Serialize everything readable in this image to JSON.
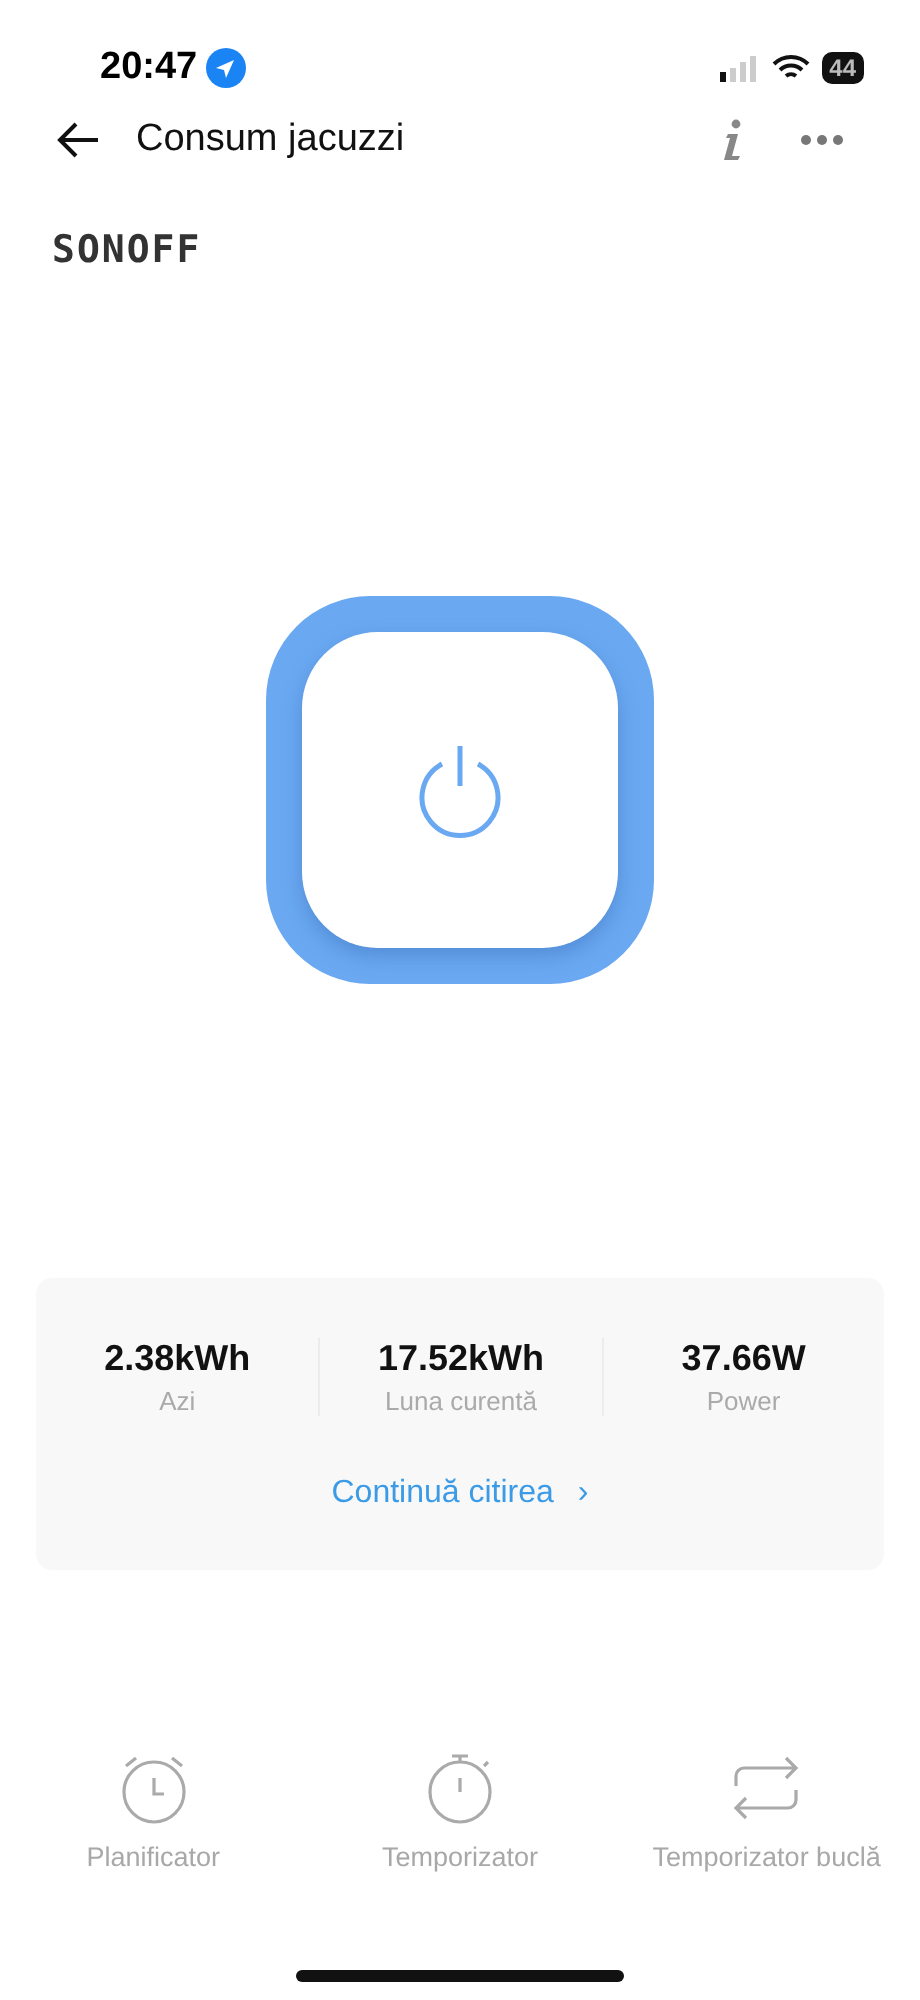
{
  "status_bar": {
    "time": "20:47",
    "battery": "44"
  },
  "header": {
    "title": "Consum jacuzzi"
  },
  "brand": "SONOFF",
  "power_switch": {
    "on": true
  },
  "stats": [
    {
      "value": "2.38kWh",
      "label": "Azi"
    },
    {
      "value": "17.52kWh",
      "label": "Luna curentă"
    },
    {
      "value": "37.66W",
      "label": "Power"
    }
  ],
  "more_link": {
    "label": "Continuă citirea",
    "arrow": "›"
  },
  "actions": [
    {
      "kind": "alarm",
      "label": "Planificator"
    },
    {
      "kind": "stopwatch",
      "label": "Temporizator"
    },
    {
      "kind": "loop",
      "label": "Temporizator buclă"
    }
  ]
}
